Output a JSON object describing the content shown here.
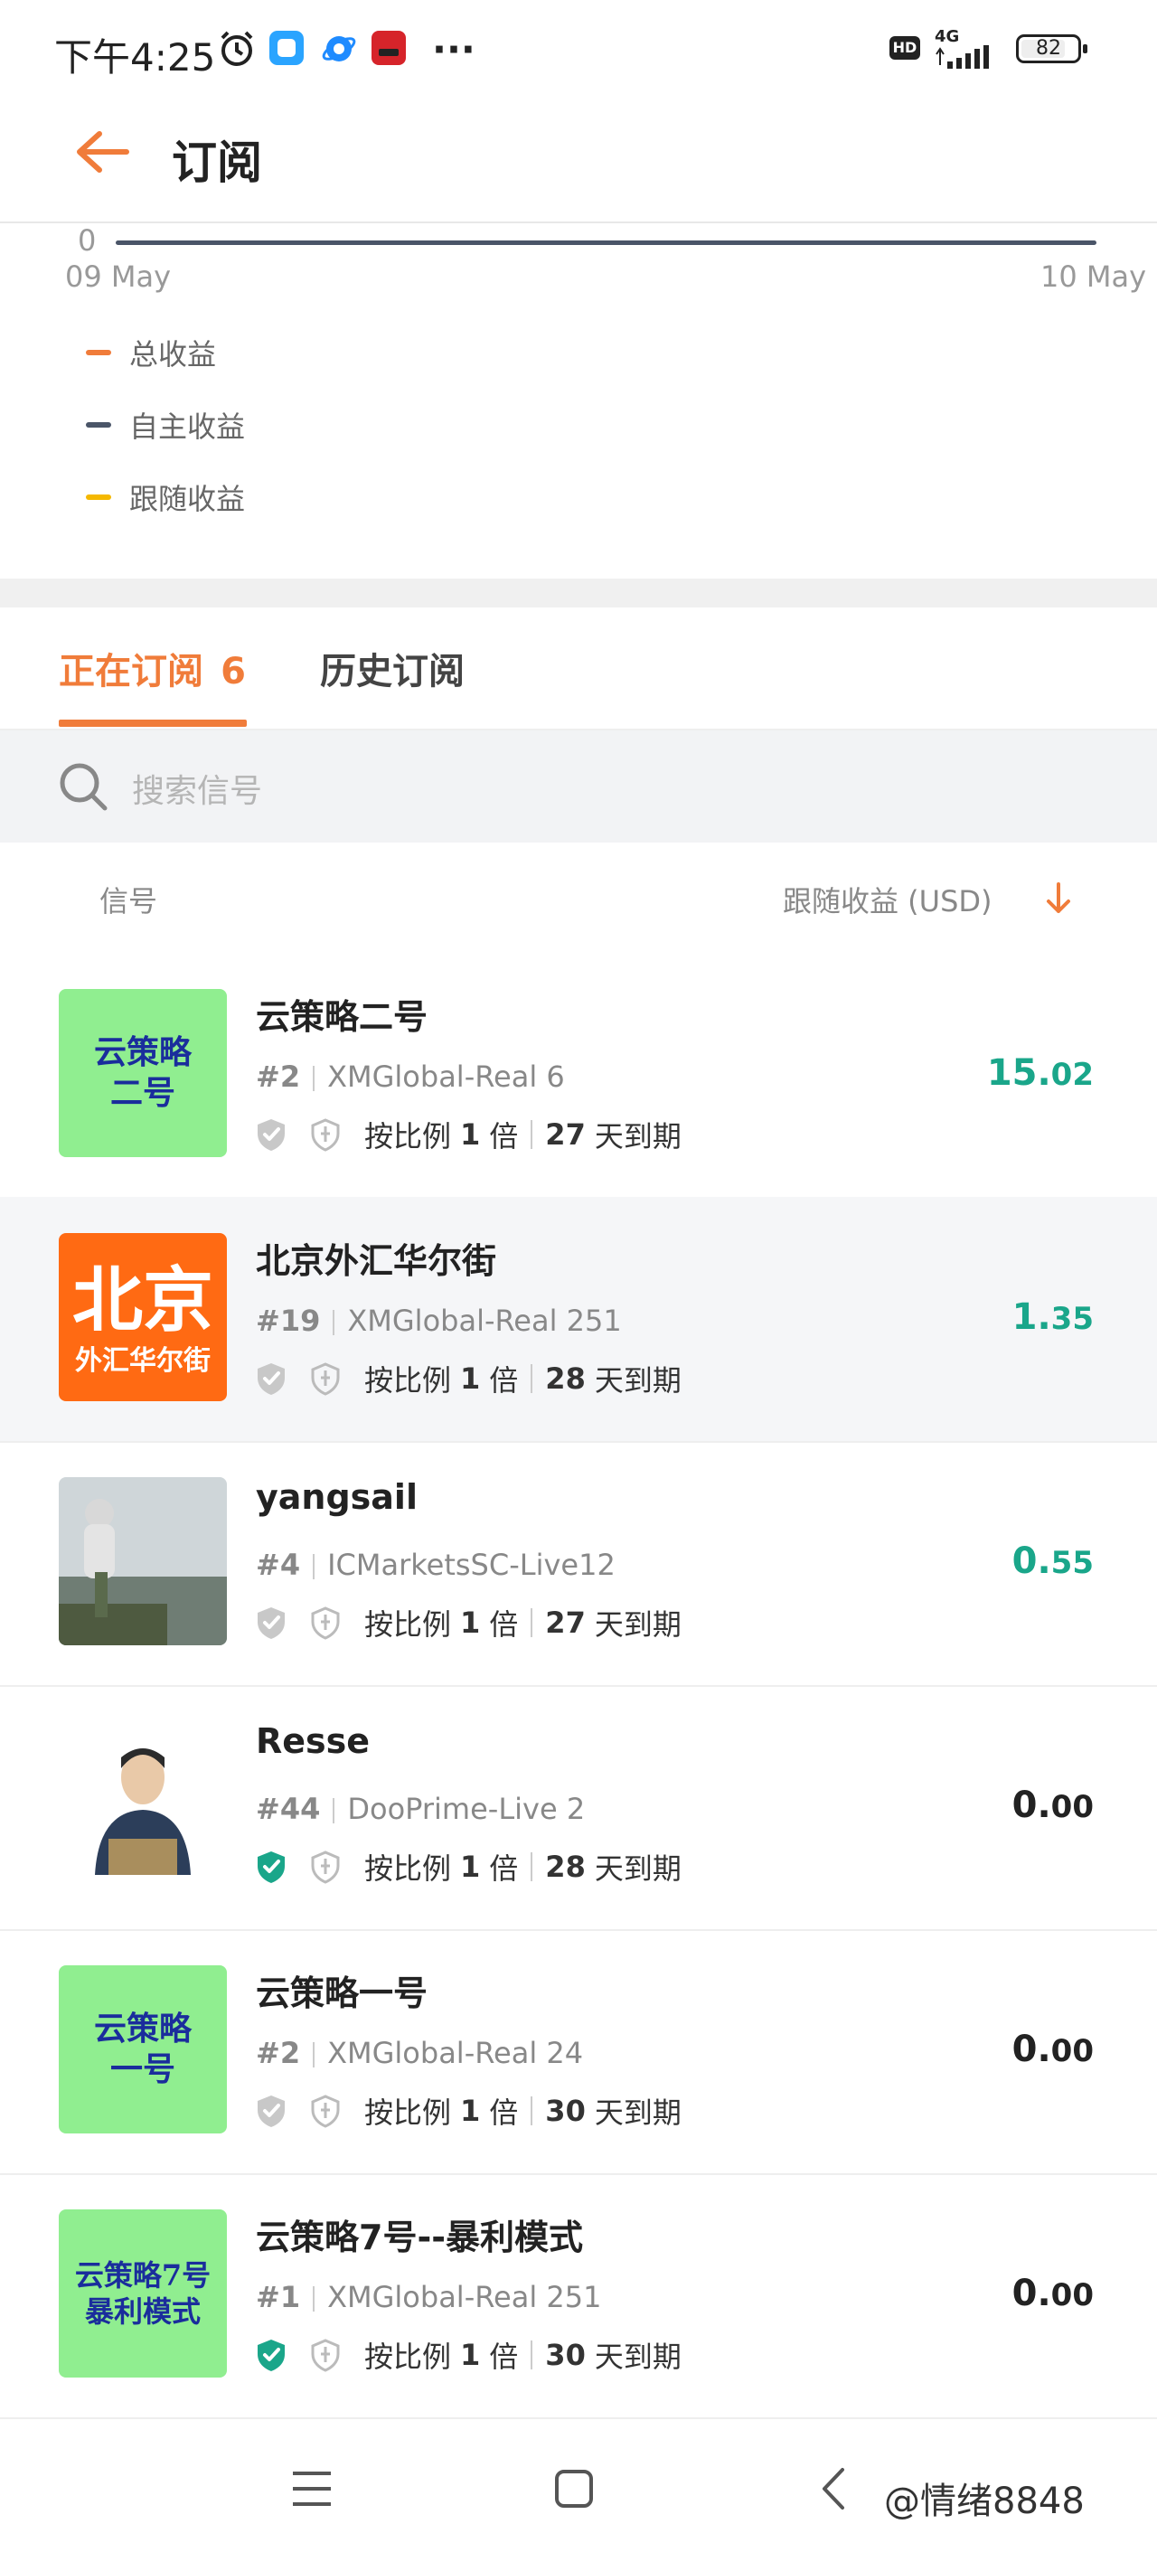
{
  "status_bar": {
    "time": "下午4:25",
    "more": "···",
    "hd": "HD",
    "network": "4G",
    "battery": "82"
  },
  "header": {
    "title": "订阅"
  },
  "chart": {
    "y_tick": "0",
    "x_start": "09 May",
    "x_end": "10 May",
    "legend": [
      {
        "label": "总收益",
        "color": "#f07c3a"
      },
      {
        "label": "自主收益",
        "color": "#4a5568"
      },
      {
        "label": "跟随收益",
        "color": "#f5b800"
      }
    ]
  },
  "tabs": {
    "active_label": "正在订阅",
    "active_count": "6",
    "history_label": "历史订阅",
    "accent": "#f07c3a"
  },
  "search": {
    "placeholder": "搜索信号"
  },
  "list_header": {
    "signal": "信号",
    "follow_profit": "跟随收益 (USD)"
  },
  "signals": [
    {
      "name": "云策略二号",
      "rank": "#2",
      "account": "XMGlobal-Real 6",
      "mode": "按比例",
      "mult": "1",
      "mult_unit": "倍",
      "days": "27",
      "days_unit": "天到期",
      "value_int": "15.",
      "value_dec": "02",
      "value_color": "#1aa68a",
      "verified": false,
      "avatar_text": [
        "云策略",
        "二号"
      ],
      "avatar_bg": "#90ee90",
      "avatar_fg": "#1a2d9c"
    },
    {
      "name": "北京外汇华尔街",
      "rank": "#19",
      "account": "XMGlobal-Real 251",
      "mode": "按比例",
      "mult": "1",
      "mult_unit": "倍",
      "days": "28",
      "days_unit": "天到期",
      "value_int": "1.",
      "value_dec": "35",
      "value_color": "#1aa68a",
      "verified": false,
      "avatar_text": [
        "北京",
        "外汇华尔街"
      ],
      "avatar_bg": "#ff6a13",
      "avatar_fg": "#ffffff"
    },
    {
      "name": "yangsail",
      "rank": "#4",
      "account": "ICMarketsSC-Live12",
      "mode": "按比例",
      "mult": "1",
      "mult_unit": "倍",
      "days": "27",
      "days_unit": "天到期",
      "value_int": "0.",
      "value_dec": "55",
      "value_color": "#1aa68a",
      "verified": false
    },
    {
      "name": "Resse",
      "rank": "#44",
      "account": "DooPrime-Live 2",
      "mode": "按比例",
      "mult": "1",
      "mult_unit": "倍",
      "days": "28",
      "days_unit": "天到期",
      "value_int": "0.",
      "value_dec": "00",
      "value_color": "#222222",
      "verified": true
    },
    {
      "name": "云策略一号",
      "rank": "#2",
      "account": "XMGlobal-Real 24",
      "mode": "按比例",
      "mult": "1",
      "mult_unit": "倍",
      "days": "30",
      "days_unit": "天到期",
      "value_int": "0.",
      "value_dec": "00",
      "value_color": "#222222",
      "verified": false,
      "avatar_text": [
        "云策略",
        "一号"
      ],
      "avatar_bg": "#90ee90",
      "avatar_fg": "#1a2d9c"
    },
    {
      "name": "云策略7号--暴利模式",
      "rank": "#1",
      "account": "XMGlobal-Real 251",
      "mode": "按比例",
      "mult": "1",
      "mult_unit": "倍",
      "days": "30",
      "days_unit": "天到期",
      "value_int": "0.",
      "value_dec": "00",
      "value_color": "#222222",
      "verified": true,
      "avatar_text": [
        "云策略7号",
        "暴利模式"
      ],
      "avatar_bg": "#90ee90",
      "avatar_fg": "#1a2d9c"
    }
  ],
  "watermark": "@情绪8848"
}
